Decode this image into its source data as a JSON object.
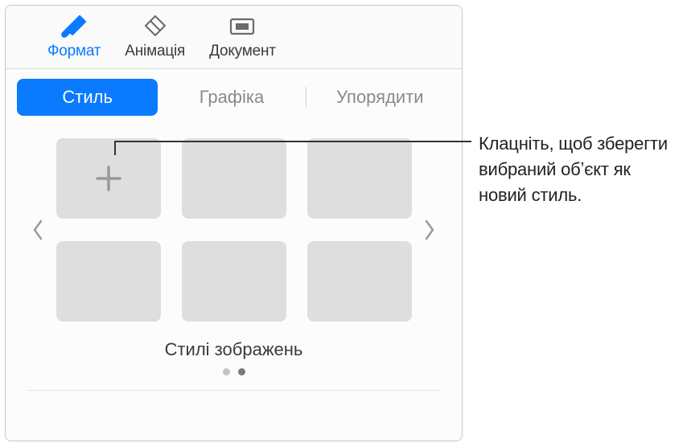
{
  "toolbar": {
    "format_label": "Формат",
    "animation_label": "Анімація",
    "document_label": "Документ"
  },
  "tabs": {
    "style": "Стиль",
    "graphic": "Графіка",
    "arrange": "Упорядити"
  },
  "styles": {
    "caption": "Стилі зображень"
  },
  "callout": {
    "text": "Клацніть, щоб зберегти вибраний обʼєкт як новий стиль."
  }
}
